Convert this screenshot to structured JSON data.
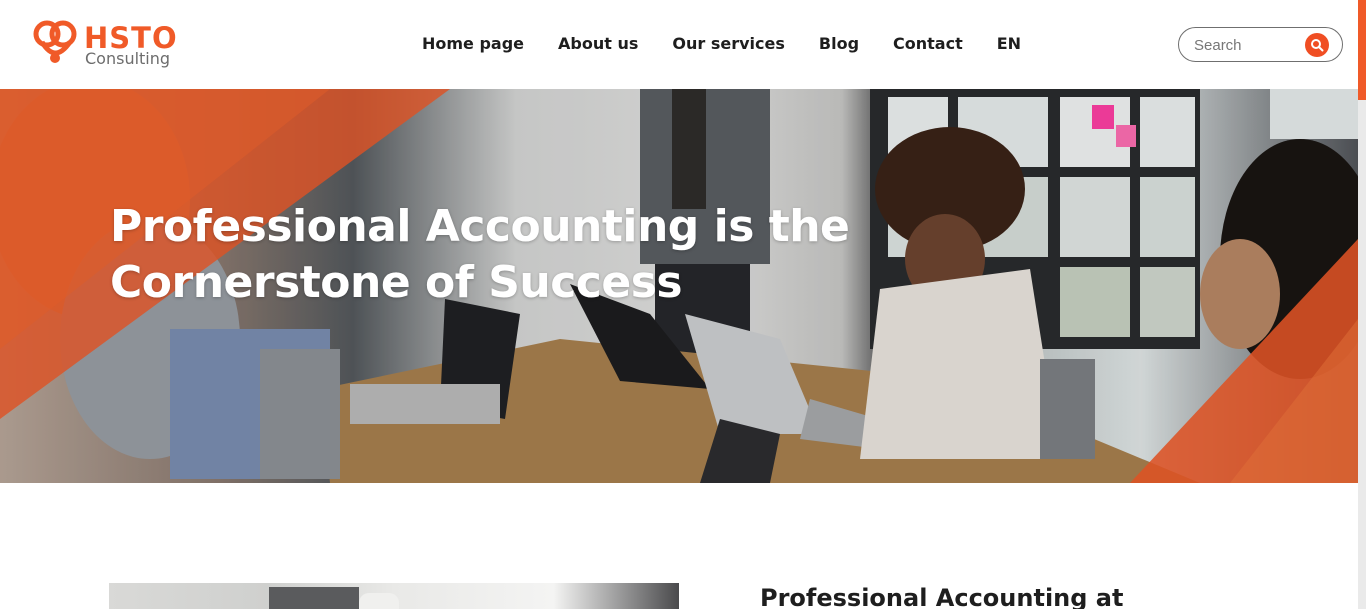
{
  "logo": {
    "name_top": "HSTO",
    "name_bottom": "Consulting"
  },
  "nav": {
    "items": [
      {
        "label": "Home page"
      },
      {
        "label": "About us"
      },
      {
        "label": "Our services"
      },
      {
        "label": "Blog"
      },
      {
        "label": "Contact"
      },
      {
        "label": "EN"
      }
    ]
  },
  "search": {
    "placeholder": "Search",
    "icon": "search-icon"
  },
  "hero": {
    "title": "Professional Accounting is the Cornerstone of Success",
    "image": "office-meeting-photo"
  },
  "section": {
    "title": "Professional Accounting at"
  },
  "colors": {
    "accent": "#f05a28",
    "text": "#1e1e1e",
    "hero_text": "#ffffff"
  }
}
